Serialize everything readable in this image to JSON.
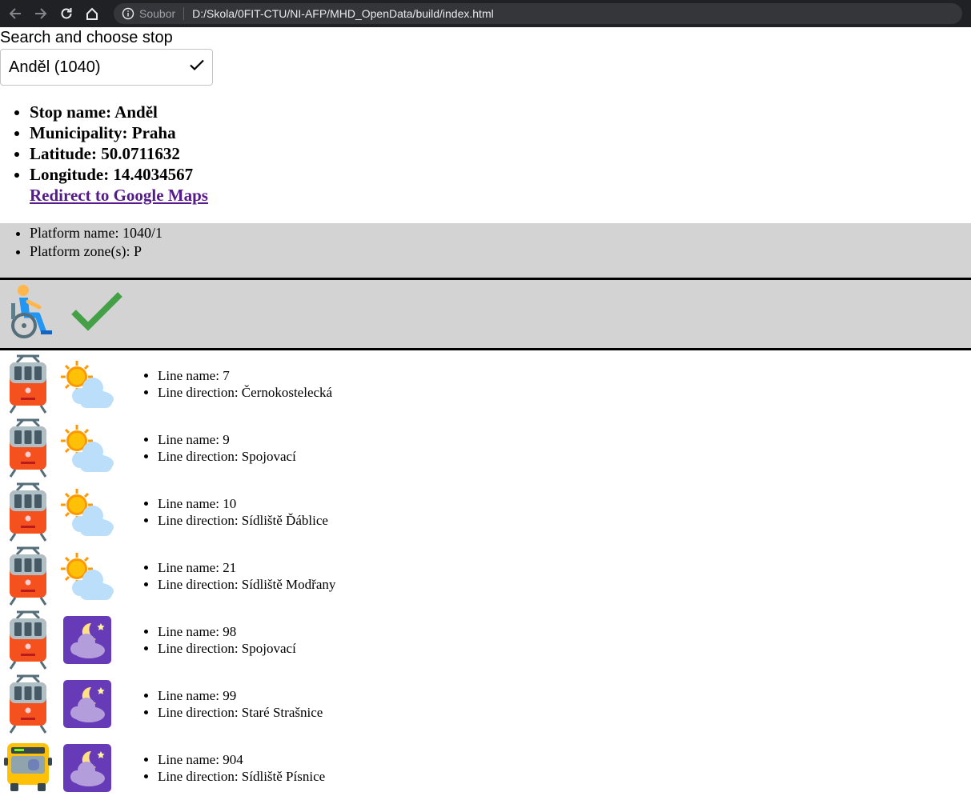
{
  "browser": {
    "scheme_label": "Soubor",
    "url": "D:/Skola/0FIT-CTU/NI-AFP/MHD_OpenData/build/index.html"
  },
  "search": {
    "label": "Search and choose stop",
    "selected_value": "Anděl (1040)"
  },
  "stop": {
    "name": "Stop name: Anděl",
    "municipality": "Municipality: Praha",
    "latitude": "Latitude: 50.0711632",
    "longitude": "Longitude: 14.4034567",
    "maps_link": "Redirect to Google Maps"
  },
  "platform": {
    "name": "Platform name: 1040/1",
    "zones": "Platform zone(s): P",
    "wheelchair_icon": "wheelchair-icon",
    "accessible_icon": "checkmark-icon"
  },
  "lines": [
    {
      "vehicle": "tram",
      "time_icon": "day",
      "name": "Line name: 7",
      "direction": "Line direction: Černokostelecká"
    },
    {
      "vehicle": "tram",
      "time_icon": "day",
      "name": "Line name: 9",
      "direction": "Line direction: Spojovací"
    },
    {
      "vehicle": "tram",
      "time_icon": "day",
      "name": "Line name: 10",
      "direction": "Line direction: Sídliště Ďáblice"
    },
    {
      "vehicle": "tram",
      "time_icon": "day",
      "name": "Line name: 21",
      "direction": "Line direction: Sídliště Modřany"
    },
    {
      "vehicle": "tram",
      "time_icon": "night",
      "name": "Line name: 98",
      "direction": "Line direction: Spojovací"
    },
    {
      "vehicle": "tram",
      "time_icon": "night",
      "name": "Line name: 99",
      "direction": "Line direction: Staré Strašnice"
    },
    {
      "vehicle": "bus",
      "time_icon": "night",
      "name": "Line name: 904",
      "direction": "Line direction: Sídliště Písnice"
    }
  ]
}
